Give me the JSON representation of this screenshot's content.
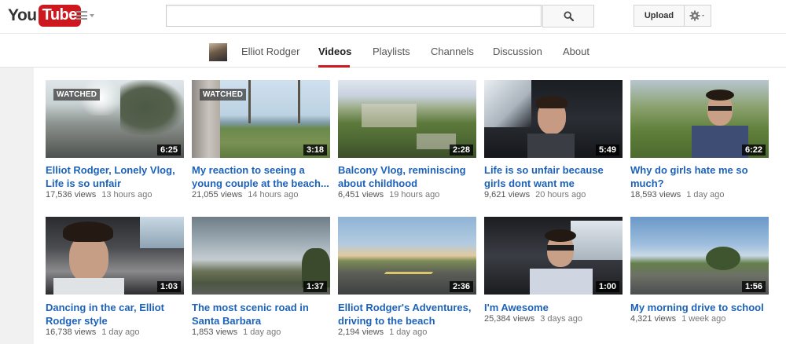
{
  "header": {
    "logo_you": "You",
    "logo_tube": "Tube",
    "search_placeholder": "",
    "upload_label": "Upload"
  },
  "channel_nav": {
    "channel_name": "Elliot Rodger",
    "tabs": [
      "Videos",
      "Playlists",
      "Channels",
      "Discussion",
      "About"
    ],
    "active_tab": "Videos"
  },
  "colors": {
    "brand_red": "#cc181e",
    "link_blue": "#1c62b9"
  },
  "videos": [
    {
      "title_line1": "Elliot Rodger, Lonely Vlog,",
      "title_line2": "Life is so unfair",
      "views": "17,536 views",
      "ago": "13 hours ago",
      "duration": "6:25",
      "badge": "WATCHED"
    },
    {
      "title_line1": "My reaction to seeing a",
      "title_line2": "young couple at the beach...",
      "views": "21,055 views",
      "ago": "14 hours ago",
      "duration": "3:18",
      "badge": "WATCHED"
    },
    {
      "title_line1": "Balcony Vlog, reminiscing",
      "title_line2": "about childhood",
      "views": "6,451 views",
      "ago": "19 hours ago",
      "duration": "2:28"
    },
    {
      "title_line1": "Life is so unfair because",
      "title_line2": "girls dont want me",
      "views": "9,621 views",
      "ago": "20 hours ago",
      "duration": "5:49"
    },
    {
      "title_line1": "Why do girls hate me so",
      "title_line2": "much?",
      "views": "18,593 views",
      "ago": "1 day ago",
      "duration": "6:22"
    },
    {
      "title_line1": "Dancing in the car, Elliot",
      "title_line2": "Rodger style",
      "views": "16,738 views",
      "ago": "1 day ago",
      "duration": "1:03"
    },
    {
      "title_line1": "The most scenic road in",
      "title_line2": "Santa Barbara",
      "views": "1,853 views",
      "ago": "1 day ago",
      "duration": "1:37"
    },
    {
      "title_line1": "Elliot Rodger's Adventures,",
      "title_line2": "driving to the beach",
      "views": "2,194 views",
      "ago": "1 day ago",
      "duration": "2:36"
    },
    {
      "title_line1": "I'm Awesome",
      "title_line2": "",
      "views": "25,384 views",
      "ago": "3 days ago",
      "duration": "1:00"
    },
    {
      "title_line1": "My morning drive to school",
      "title_line2": "",
      "views": "4,321 views",
      "ago": "1 week ago",
      "duration": "1:56"
    }
  ]
}
